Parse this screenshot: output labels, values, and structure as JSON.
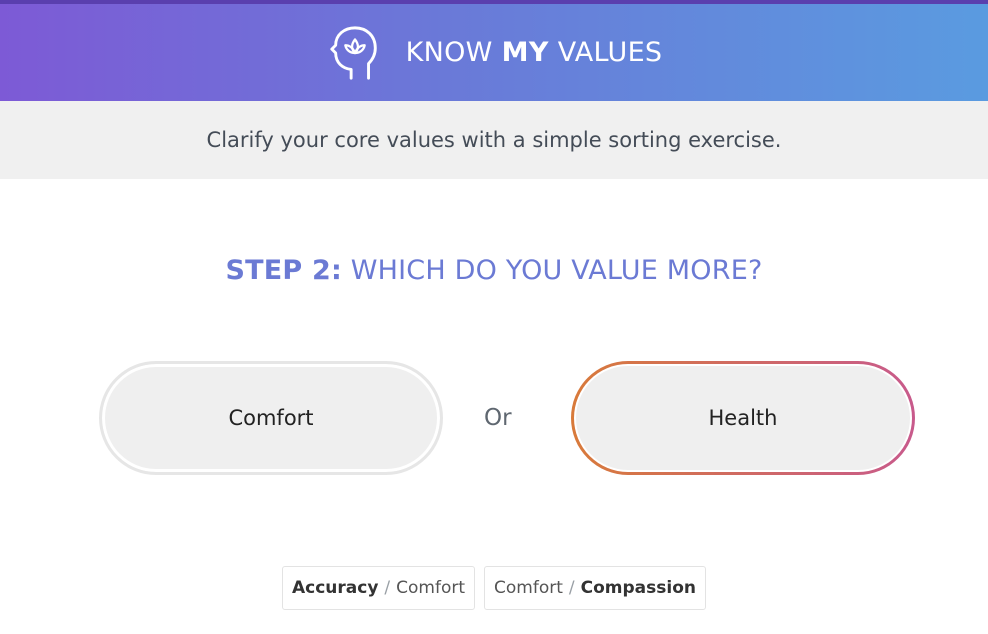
{
  "header": {
    "brand_word1": "KNOW",
    "brand_word2": "MY",
    "brand_word3": "VALUES",
    "logo_icon": "head-lotus-icon"
  },
  "tagline": "Clarify your core values with a simple sorting exercise.",
  "step": {
    "label": "STEP 2:",
    "question": "WHICH DO YOU VALUE MORE?"
  },
  "choices": {
    "left": "Comfort",
    "separator": "Or",
    "right": "Health"
  },
  "history": [
    {
      "first": "Accuracy",
      "second": "Comfort",
      "chosen": "first",
      "sep": "/"
    },
    {
      "first": "Comfort",
      "second": "Compassion",
      "chosen": "second",
      "sep": "/"
    }
  ],
  "colors": {
    "header_gradient_start": "#7d5ad6",
    "header_gradient_end": "#5a9be0",
    "accent": "#6b7ad4",
    "selected_border_start": "#d87a3a",
    "selected_border_end": "#c85a8c"
  }
}
